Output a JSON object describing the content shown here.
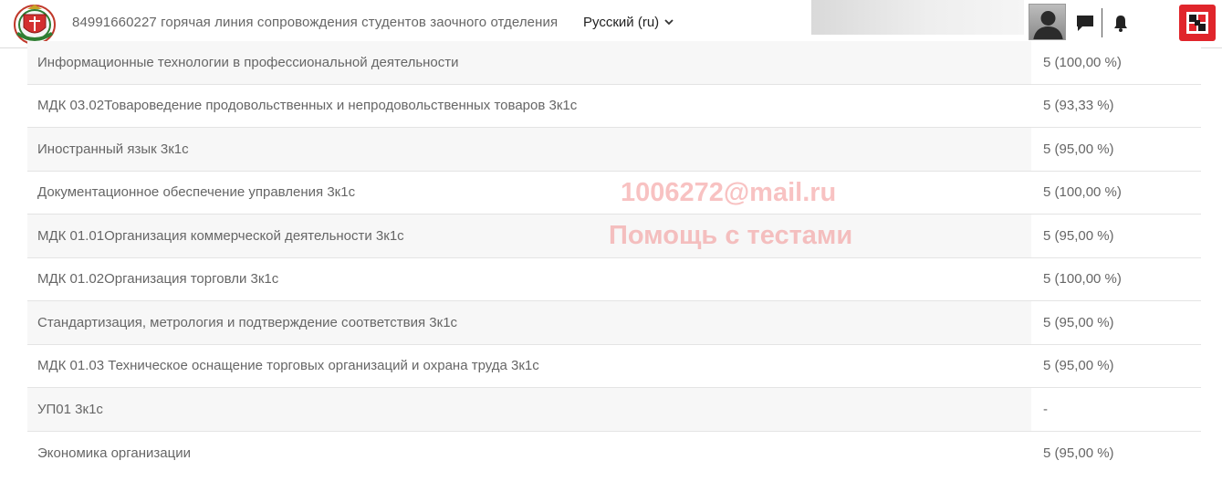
{
  "header": {
    "hotline": "84991660227 горячая линия сопровождения студентов заочного отделения",
    "language": "Русский (ru)"
  },
  "watermark": {
    "email": "1006272@mail.ru",
    "help": "Помощь с тестами"
  },
  "courses": [
    {
      "name": "Информационные технологии в профессиональной деятельности",
      "grade": "5 (100,00 %)"
    },
    {
      "name": "МДК 03.02Товароведение продовольственных и непродовольственных товаров 3к1с",
      "grade": "5 (93,33 %)"
    },
    {
      "name": "Иностранный язык 3к1с",
      "grade": "5 (95,00 %)"
    },
    {
      "name": "Документационное обеспечение управления 3к1с",
      "grade": "5 (100,00 %)"
    },
    {
      "name": "МДК 01.01Организация коммерческой деятельности 3к1с",
      "grade": "5 (95,00 %)"
    },
    {
      "name": "МДК 01.02Организация торговли 3к1с",
      "grade": "5 (100,00 %)"
    },
    {
      "name": "Стандартизация, метрология и подтверждение соответствия 3к1с",
      "grade": "5 (95,00 %)"
    },
    {
      "name": "МДК 01.03 Техническое оснащение торговых организаций и охрана труда 3к1с",
      "grade": "5 (95,00 %)"
    },
    {
      "name": "УП01 3к1с",
      "grade": "-"
    },
    {
      "name": "Экономика организации",
      "grade": "5 (95,00 %)"
    }
  ]
}
